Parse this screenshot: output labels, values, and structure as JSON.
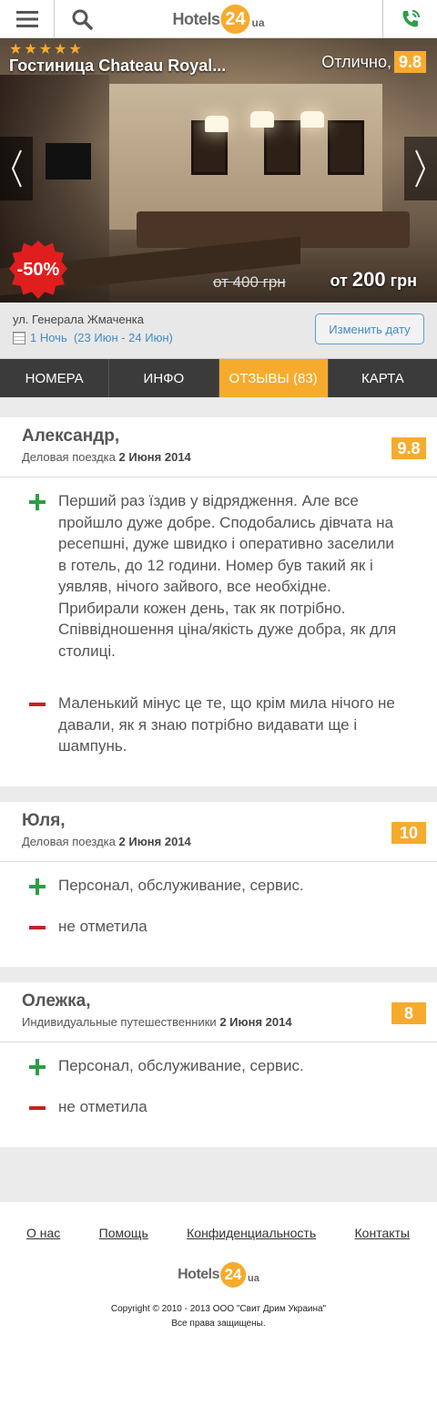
{
  "header": {
    "logo_word": "Hotels",
    "logo_num": "24",
    "logo_ua": "ua"
  },
  "hero": {
    "stars": "★★★★★",
    "title": "Гостиница Chateau Royal...",
    "rating_label": "Отлично,",
    "rating_value": "9.8",
    "discount": "-50%",
    "old_price": "от 400 грн",
    "price_prefix": "от",
    "price_amount": "200",
    "price_currency": "грн"
  },
  "info": {
    "address": "ул. Генерала Жмаченка",
    "dates": "1 Ночь  (23 Июн - 24 Июн)",
    "change_date_label": "Изменить дату"
  },
  "tabs": [
    {
      "label": "НОМЕРА"
    },
    {
      "label": "ИНФО"
    },
    {
      "label": "ОТЗЫВЫ (83)"
    },
    {
      "label": "КАРТА"
    }
  ],
  "reviews": [
    {
      "name": "Александр,",
      "trip": "Деловая поездка",
      "date": "2 Июня 2014",
      "score": "9.8",
      "plus": "Перший раз їздив у відрядження. Але все пройшло дуже добре. Сподобались дівчата на ресепшні, дуже швидко і оперативно заселили в готель, до 12 години. Номер був такий як і уявляв, нічого зайвого, все необхідне. Прибирали кожен день, так як потрібно. Співвідношення ціна/якість дуже добра, як для столиці.",
      "minus": "Маленький мінус це те, що крім мила нічого не давали, як я знаю потрібно видавати ще і шампунь."
    },
    {
      "name": "Юля,",
      "trip": "Деловая поездка",
      "date": "2 Июня 2014",
      "score": "10",
      "plus": "Персонал, обслуживание, сервис.",
      "minus": "не отметила"
    },
    {
      "name": "Олежка,",
      "trip": "Индивидуальные путешественники",
      "date": "2 Июня 2014",
      "score": "8",
      "plus": "Персонал, обслуживание, сервис.",
      "minus": "не отметила"
    }
  ],
  "footer": {
    "links": [
      "О нас",
      "Помощь",
      "Конфиденциальность",
      "Контакты"
    ],
    "copyright": "Copyright © 2010 - 2013 ООО \"Свит Дрим Украина\"",
    "rights": "Все права защищены."
  },
  "colors": {
    "accent": "#f6ab2e",
    "plus": "#2e9e47",
    "minus": "#c42222",
    "tab_bg": "#3b3b3b"
  }
}
